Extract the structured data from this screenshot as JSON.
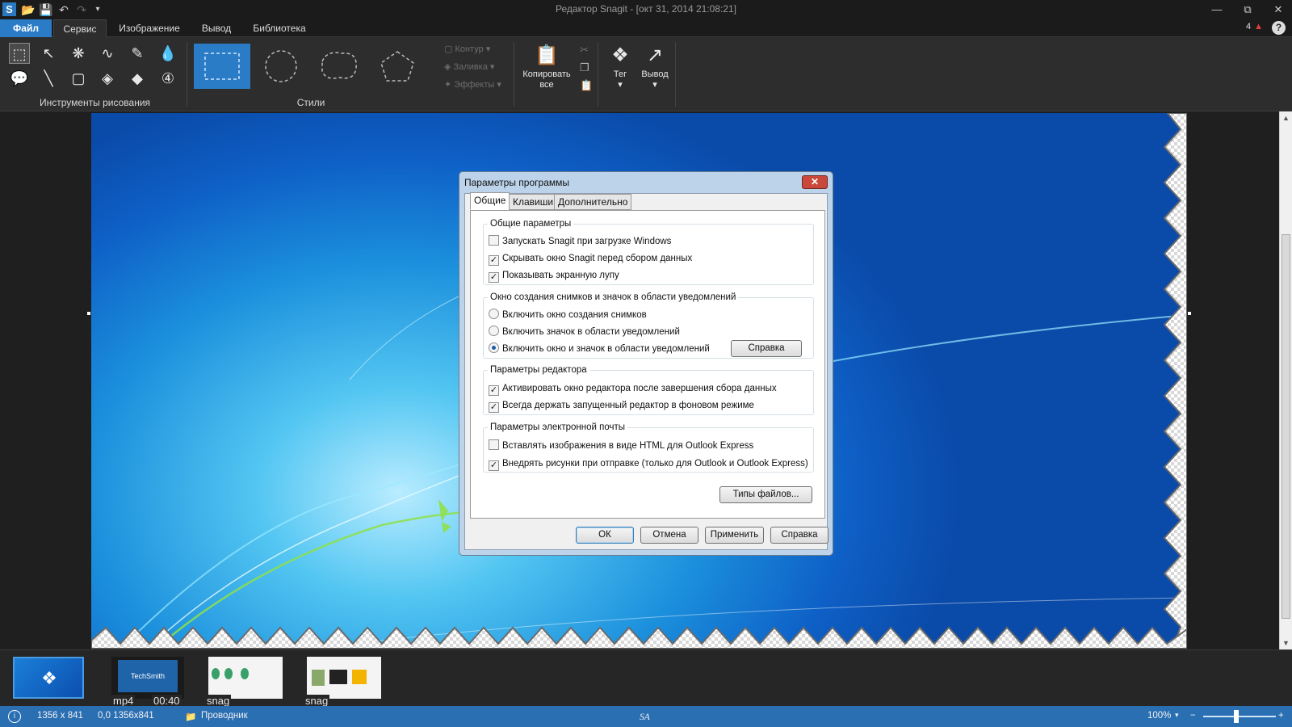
{
  "window": {
    "title": "Редактор Snagit - [окт 31, 2014 21:08:21]",
    "app_icon_letter": "S"
  },
  "menu": {
    "file": "Файл",
    "tabs": [
      "Сервис",
      "Изображение",
      "Вывод",
      "Библиотека"
    ],
    "notification_count": "4"
  },
  "ribbon": {
    "drawing_tools_label": "Инструменты рисования",
    "styles_label": "Стили",
    "outline": "Контур",
    "fill": "Заливка",
    "effects": "Эффекты",
    "copy_all_line1": "Копировать",
    "copy_all_line2": "все",
    "tag": "Тег",
    "output": "Вывод"
  },
  "dialog": {
    "title": "Параметры программы",
    "tabs": [
      "Общие",
      "Клавиши",
      "Дополнительно"
    ],
    "general_group": {
      "legend": "Общие параметры",
      "items": [
        {
          "label": "Запускать Snagit при загрузке Windows",
          "checked": false
        },
        {
          "label": "Скрывать окно Snagit перед сбором данных",
          "checked": true
        },
        {
          "label": "Показывать экранную лупу",
          "checked": true
        }
      ]
    },
    "capture_group": {
      "legend": "Окно создания снимков и значок в области уведомлений",
      "items": [
        {
          "label": "Включить окно создания снимков",
          "selected": false
        },
        {
          "label": "Включить значок в области уведомлений",
          "selected": false
        },
        {
          "label": "Включить окно и значок в области уведомлений",
          "selected": true
        }
      ],
      "help_button": "Справка"
    },
    "editor_group": {
      "legend": "Параметры редактора",
      "items": [
        {
          "label": "Активировать окно редактора после завершения сбора данных",
          "checked": true
        },
        {
          "label": "Всегда держать запущенный редактор в фоновом режиме",
          "checked": true
        }
      ]
    },
    "email_group": {
      "legend": "Параметры электронной почты",
      "items": [
        {
          "label": "Вставлять изображения в виде HTML для Outlook Express",
          "checked": false
        },
        {
          "label": "Внедрять рисунки при отправке (только для Outlook и Outlook Express)",
          "checked": true
        }
      ]
    },
    "file_types_button": "Типы файлов...",
    "buttons": {
      "ok": "ОК",
      "cancel": "Отмена",
      "apply": "Применить",
      "help": "Справка"
    }
  },
  "tray": {
    "items": [
      {
        "caption": "",
        "kind": "windows7"
      },
      {
        "caption": "mp4",
        "duration": "00:40",
        "kind": "video",
        "brand": "TechSmith"
      },
      {
        "caption": "snag",
        "kind": "tips"
      },
      {
        "caption": "snag",
        "kind": "screens"
      }
    ]
  },
  "status": {
    "dimensions": "1356 x 841",
    "coords": "0,0  1356x841",
    "source": "Проводник",
    "zoom": "100%",
    "watermark": "SA"
  }
}
